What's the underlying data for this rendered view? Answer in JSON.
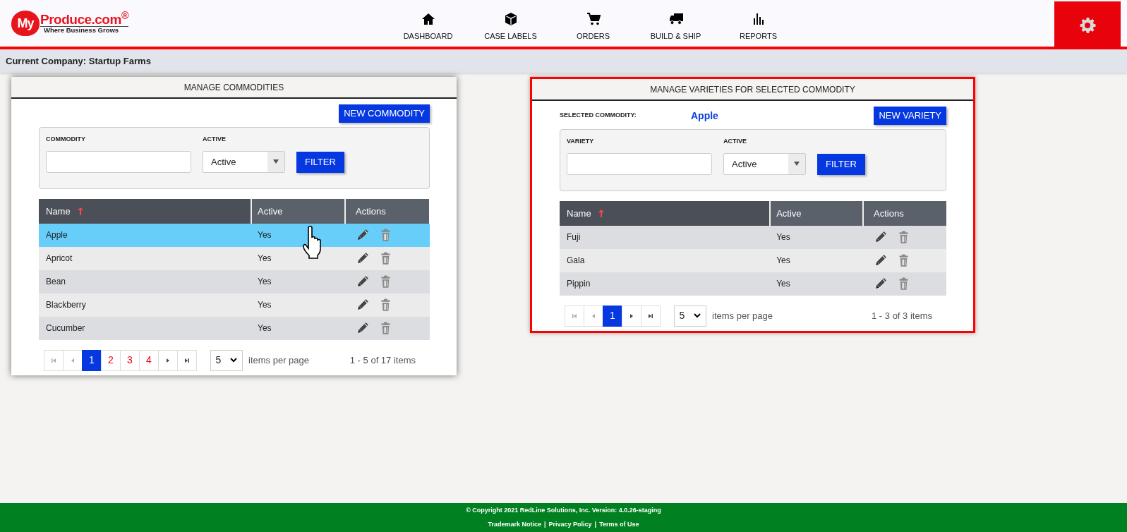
{
  "header": {
    "logo": {
      "mark": "My",
      "wordmark": "Produce.com$^{®}$",
      "tagline": "Where Business Grows"
    },
    "nav": [
      {
        "label": "DASHBOARD"
      },
      {
        "label": "CASE LABELS"
      },
      {
        "label": "ORDERS"
      },
      {
        "label": "BUILD & SHIP"
      },
      {
        "label": "REPORTS"
      }
    ]
  },
  "company_bar": "Current Company: Startup Farms",
  "panels": [
    {
      "title": "MANAGE COMMODITIES",
      "highlighted": false,
      "new_button": "NEW COMMODITY",
      "filters": {
        "text_label": "COMMODITY",
        "active_label": "ACTIVE",
        "active_value": "Active",
        "filter_button": "FILTER"
      },
      "columns": [
        {
          "label": "Name",
          "sorted": true
        },
        {
          "label": "Active",
          "sorted": false
        },
        {
          "label": "Actions",
          "sorted": false
        }
      ],
      "rows": [
        {
          "name": "Apple",
          "active": "Yes",
          "selected": true
        },
        {
          "name": "Apricot",
          "active": "Yes",
          "selected": false
        },
        {
          "name": "Bean",
          "active": "Yes",
          "selected": false
        },
        {
          "name": "Blackberry",
          "active": "Yes",
          "selected": false
        },
        {
          "name": "Cucumber",
          "active": "Yes",
          "selected": false
        }
      ],
      "pager": {
        "pages": [
          {
            "label": "1",
            "selected": true
          },
          {
            "label": "2",
            "selected": false
          },
          {
            "label": "3",
            "selected": false
          },
          {
            "label": "4",
            "selected": false
          }
        ],
        "page_size": "5",
        "page_size_label": "items per page",
        "summary": "1 - 5 of 17 items"
      }
    },
    {
      "title": "MANAGE VARIETIES FOR SELECTED COMMODITY",
      "highlighted": true,
      "selected_label": "SELECTED COMMODITY:",
      "selected_value": "Apple",
      "new_button": "NEW VARIETY",
      "filters": {
        "text_label": "VARIETY",
        "active_label": "ACTIVE",
        "active_value": "Active",
        "filter_button": "FILTER"
      },
      "columns": [
        {
          "label": "Name",
          "sorted": true
        },
        {
          "label": "Active",
          "sorted": false
        },
        {
          "label": "Actions",
          "sorted": false
        }
      ],
      "rows": [
        {
          "name": "Fuji",
          "active": "Yes",
          "selected": false
        },
        {
          "name": "Gala",
          "active": "Yes",
          "selected": false
        },
        {
          "name": "Pippin",
          "active": "Yes",
          "selected": false
        }
      ],
      "pager": {
        "pages": [
          {
            "label": "1",
            "selected": true
          }
        ],
        "page_size": "5",
        "page_size_label": "items per page",
        "summary": "1 - 3 of 3 items"
      }
    }
  ],
  "footer": {
    "copyright": "© Copyright 2021 RedLine Solutions, Inc. Version: 4.0.26-staging",
    "links": [
      "Trademark Notice",
      "Privacy Policy",
      "Terms of Use"
    ],
    "separator": "|"
  }
}
